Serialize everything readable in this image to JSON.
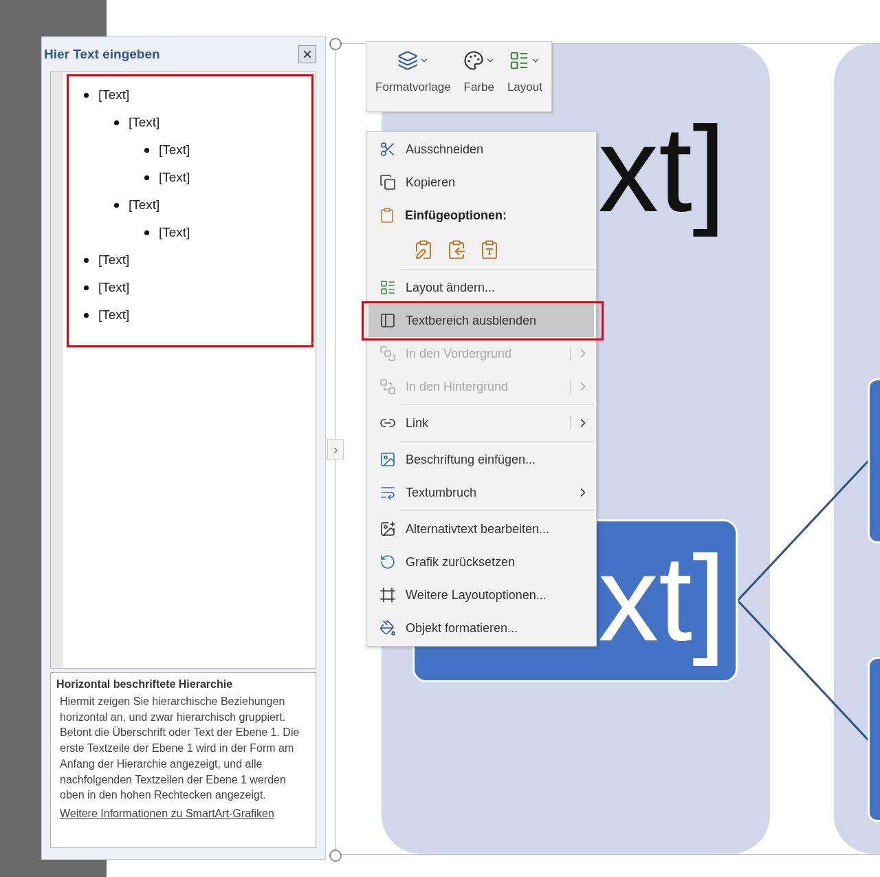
{
  "text_pane": {
    "title": "Hier Text eingeben",
    "close": "×",
    "highlighted": true,
    "items": [
      {
        "text": "[Text]",
        "children": [
          {
            "text": "[Text]",
            "children": [
              {
                "text": "[Text]"
              },
              {
                "text": "[Text]"
              }
            ]
          },
          {
            "text": "[Text]",
            "children": [
              {
                "text": "[Text]"
              }
            ]
          }
        ]
      },
      {
        "text": "[Text]"
      },
      {
        "text": "[Text]"
      },
      {
        "text": "[Text]"
      }
    ],
    "info": {
      "heading": "Horizontal beschriftete Hierarchie",
      "body": "Hiermit zeigen Sie hierarchische Beziehungen horizontal an, und zwar hierarchisch gruppiert. Betont die Überschrift oder Text der Ebene 1. Die erste Textzeile der Ebene 1 wird in der Form am Anfang der Hierarchie angezeigt, und alle nachfolgenden Textzeilen der Ebene 1 werden oben in den hohen Rechtecken angezeigt.",
      "link": "Weitere Informationen zu SmartArt-Grafiken"
    }
  },
  "slide": {
    "top_text": "xt]",
    "box_text": "xt]",
    "expander": "›"
  },
  "mini_toolbar": [
    {
      "kind": "style",
      "label": "Formatvorlage"
    },
    {
      "kind": "color",
      "label": "Farbe"
    },
    {
      "kind": "layout",
      "label": "Layout"
    }
  ],
  "context_menu": [
    {
      "kind": "item",
      "label": "Ausschneiden",
      "disabled": false,
      "selected": false,
      "outlined": false
    },
    {
      "kind": "item",
      "label": "Kopieren",
      "disabled": false,
      "selected": false,
      "outlined": false
    },
    {
      "kind": "header",
      "label": "Einfügeoptionen:"
    },
    {
      "kind": "paste-options"
    },
    {
      "kind": "separator"
    },
    {
      "kind": "item",
      "label": "Layout ändern...",
      "disabled": false,
      "selected": false,
      "outlined": false
    },
    {
      "kind": "item",
      "label": "Textbereich ausblenden",
      "disabled": false,
      "selected": true,
      "outlined": true
    },
    {
      "kind": "split-submenu",
      "label": "In den Vordergrund",
      "disabled": true,
      "selected": false,
      "outlined": false
    },
    {
      "kind": "split-submenu",
      "label": "In den Hintergrund",
      "disabled": true,
      "selected": false,
      "outlined": false
    },
    {
      "kind": "separator"
    },
    {
      "kind": "split-submenu",
      "label": "Link",
      "disabled": false,
      "selected": false,
      "outlined": false
    },
    {
      "kind": "separator"
    },
    {
      "kind": "item",
      "label": "Beschriftung einfügen...",
      "disabled": false,
      "selected": false,
      "outlined": false
    },
    {
      "kind": "submenu",
      "label": "Textumbruch",
      "disabled": false,
      "selected": false,
      "outlined": false
    },
    {
      "kind": "separator"
    },
    {
      "kind": "item",
      "label": "Alternativtext bearbeiten...",
      "disabled": false,
      "selected": false,
      "outlined": false
    },
    {
      "kind": "item",
      "label": "Grafik zurücksetzen",
      "disabled": false,
      "selected": false,
      "outlined": false
    },
    {
      "kind": "item",
      "label": "Weitere Layoutoptionen...",
      "disabled": false,
      "selected": false,
      "outlined": false
    },
    {
      "kind": "item",
      "label": "Objekt formatieren...",
      "disabled": false,
      "selected": false,
      "outlined": false
    }
  ]
}
